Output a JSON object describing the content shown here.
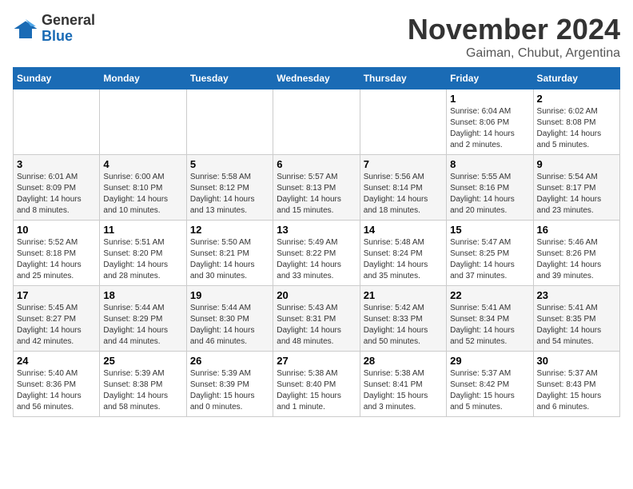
{
  "header": {
    "logo_line1": "General",
    "logo_line2": "Blue",
    "month_title": "November 2024",
    "location": "Gaiman, Chubut, Argentina"
  },
  "weekdays": [
    "Sunday",
    "Monday",
    "Tuesday",
    "Wednesday",
    "Thursday",
    "Friday",
    "Saturday"
  ],
  "weeks": [
    [
      {
        "day": "",
        "info": ""
      },
      {
        "day": "",
        "info": ""
      },
      {
        "day": "",
        "info": ""
      },
      {
        "day": "",
        "info": ""
      },
      {
        "day": "",
        "info": ""
      },
      {
        "day": "1",
        "info": "Sunrise: 6:04 AM\nSunset: 8:06 PM\nDaylight: 14 hours and 2 minutes."
      },
      {
        "day": "2",
        "info": "Sunrise: 6:02 AM\nSunset: 8:08 PM\nDaylight: 14 hours and 5 minutes."
      }
    ],
    [
      {
        "day": "3",
        "info": "Sunrise: 6:01 AM\nSunset: 8:09 PM\nDaylight: 14 hours and 8 minutes."
      },
      {
        "day": "4",
        "info": "Sunrise: 6:00 AM\nSunset: 8:10 PM\nDaylight: 14 hours and 10 minutes."
      },
      {
        "day": "5",
        "info": "Sunrise: 5:58 AM\nSunset: 8:12 PM\nDaylight: 14 hours and 13 minutes."
      },
      {
        "day": "6",
        "info": "Sunrise: 5:57 AM\nSunset: 8:13 PM\nDaylight: 14 hours and 15 minutes."
      },
      {
        "day": "7",
        "info": "Sunrise: 5:56 AM\nSunset: 8:14 PM\nDaylight: 14 hours and 18 minutes."
      },
      {
        "day": "8",
        "info": "Sunrise: 5:55 AM\nSunset: 8:16 PM\nDaylight: 14 hours and 20 minutes."
      },
      {
        "day": "9",
        "info": "Sunrise: 5:54 AM\nSunset: 8:17 PM\nDaylight: 14 hours and 23 minutes."
      }
    ],
    [
      {
        "day": "10",
        "info": "Sunrise: 5:52 AM\nSunset: 8:18 PM\nDaylight: 14 hours and 25 minutes."
      },
      {
        "day": "11",
        "info": "Sunrise: 5:51 AM\nSunset: 8:20 PM\nDaylight: 14 hours and 28 minutes."
      },
      {
        "day": "12",
        "info": "Sunrise: 5:50 AM\nSunset: 8:21 PM\nDaylight: 14 hours and 30 minutes."
      },
      {
        "day": "13",
        "info": "Sunrise: 5:49 AM\nSunset: 8:22 PM\nDaylight: 14 hours and 33 minutes."
      },
      {
        "day": "14",
        "info": "Sunrise: 5:48 AM\nSunset: 8:24 PM\nDaylight: 14 hours and 35 minutes."
      },
      {
        "day": "15",
        "info": "Sunrise: 5:47 AM\nSunset: 8:25 PM\nDaylight: 14 hours and 37 minutes."
      },
      {
        "day": "16",
        "info": "Sunrise: 5:46 AM\nSunset: 8:26 PM\nDaylight: 14 hours and 39 minutes."
      }
    ],
    [
      {
        "day": "17",
        "info": "Sunrise: 5:45 AM\nSunset: 8:27 PM\nDaylight: 14 hours and 42 minutes."
      },
      {
        "day": "18",
        "info": "Sunrise: 5:44 AM\nSunset: 8:29 PM\nDaylight: 14 hours and 44 minutes."
      },
      {
        "day": "19",
        "info": "Sunrise: 5:44 AM\nSunset: 8:30 PM\nDaylight: 14 hours and 46 minutes."
      },
      {
        "day": "20",
        "info": "Sunrise: 5:43 AM\nSunset: 8:31 PM\nDaylight: 14 hours and 48 minutes."
      },
      {
        "day": "21",
        "info": "Sunrise: 5:42 AM\nSunset: 8:33 PM\nDaylight: 14 hours and 50 minutes."
      },
      {
        "day": "22",
        "info": "Sunrise: 5:41 AM\nSunset: 8:34 PM\nDaylight: 14 hours and 52 minutes."
      },
      {
        "day": "23",
        "info": "Sunrise: 5:41 AM\nSunset: 8:35 PM\nDaylight: 14 hours and 54 minutes."
      }
    ],
    [
      {
        "day": "24",
        "info": "Sunrise: 5:40 AM\nSunset: 8:36 PM\nDaylight: 14 hours and 56 minutes."
      },
      {
        "day": "25",
        "info": "Sunrise: 5:39 AM\nSunset: 8:38 PM\nDaylight: 14 hours and 58 minutes."
      },
      {
        "day": "26",
        "info": "Sunrise: 5:39 AM\nSunset: 8:39 PM\nDaylight: 15 hours and 0 minutes."
      },
      {
        "day": "27",
        "info": "Sunrise: 5:38 AM\nSunset: 8:40 PM\nDaylight: 15 hours and 1 minute."
      },
      {
        "day": "28",
        "info": "Sunrise: 5:38 AM\nSunset: 8:41 PM\nDaylight: 15 hours and 3 minutes."
      },
      {
        "day": "29",
        "info": "Sunrise: 5:37 AM\nSunset: 8:42 PM\nDaylight: 15 hours and 5 minutes."
      },
      {
        "day": "30",
        "info": "Sunrise: 5:37 AM\nSunset: 8:43 PM\nDaylight: 15 hours and 6 minutes."
      }
    ]
  ]
}
